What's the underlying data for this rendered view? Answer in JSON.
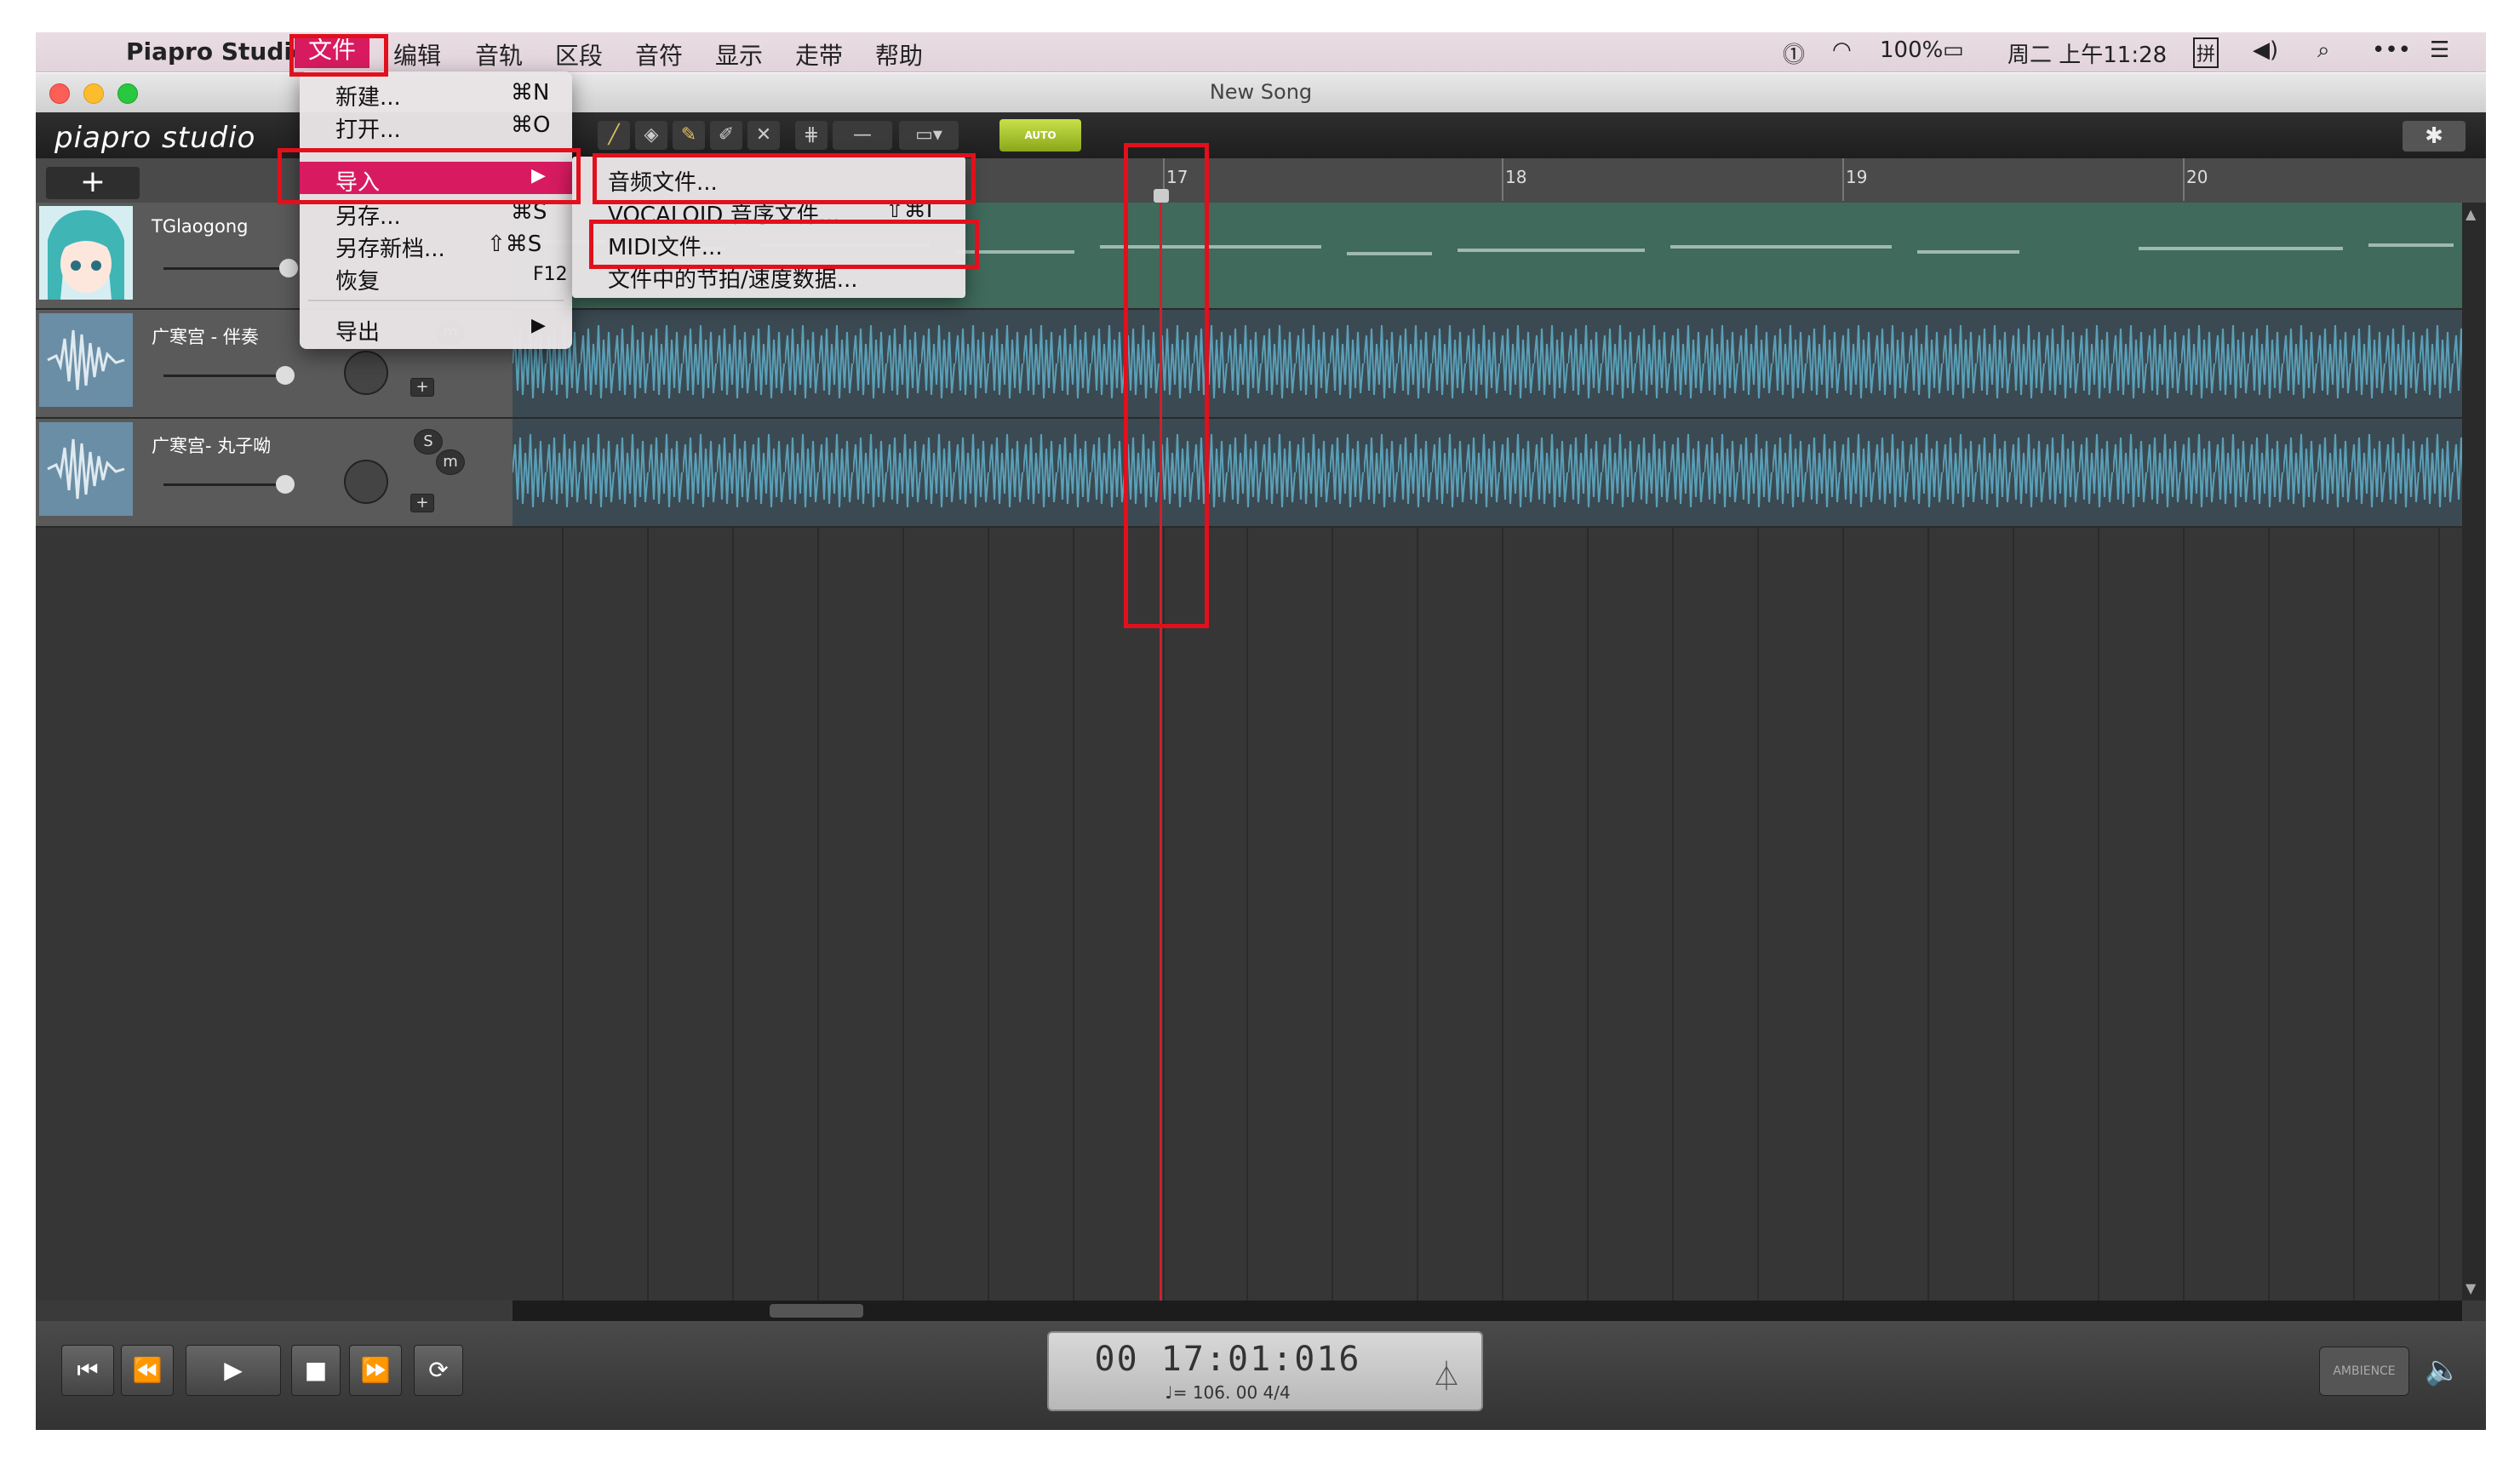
{
  "menubar": {
    "apple_icon": "apple-icon",
    "app_name": "Piapro Studio",
    "items": [
      "文件",
      "编辑",
      "音轨",
      "区段",
      "音符",
      "显示",
      "走带",
      "帮助"
    ],
    "status": {
      "battery": "100%",
      "clock": "周二 上午11:28",
      "input_method": "拼"
    }
  },
  "window": {
    "title": "New Song",
    "logo": "piapro studio",
    "auto_label": "AUTO"
  },
  "ruler": {
    "add_label": "+",
    "bars": [
      "17",
      "18",
      "19",
      "20"
    ]
  },
  "tracks": [
    {
      "name": "TGlaogong",
      "type": "vocal"
    },
    {
      "name": "广寒宫 - 伴奏",
      "type": "audio",
      "m": "m",
      "plus": "+"
    },
    {
      "name": "广寒宫- 丸子呦",
      "type": "audio",
      "s": "S",
      "m": "m",
      "plus": "+"
    }
  ],
  "file_menu": {
    "items": [
      {
        "label": "新建...",
        "shortcut": "⌘N"
      },
      {
        "label": "打开...",
        "shortcut": "⌘O"
      },
      {
        "label": "导入",
        "shortcut": "▶"
      },
      {
        "label": "另存...",
        "shortcut": "⌘S"
      },
      {
        "label": "另存新档...",
        "shortcut": "⇧⌘S"
      },
      {
        "label": "恢复",
        "shortcut": "F12"
      },
      {
        "label": "导出",
        "shortcut": "▶"
      }
    ]
  },
  "import_submenu": {
    "items": [
      {
        "label": "音频文件...",
        "shortcut": ""
      },
      {
        "label": "VOCALOID 音序文件...",
        "shortcut": "⇧⌘I"
      },
      {
        "label": "MIDI文件...",
        "shortcut": ""
      },
      {
        "label": "文件中的节拍/速度数据...",
        "shortcut": ""
      }
    ]
  },
  "transport": {
    "time": "00 17:01:016",
    "tempo_sig": "♩= 106. 00   4/4",
    "ambience": "AMBIENCE"
  },
  "colors": {
    "highlight": "#d81b60",
    "annotation": "#e1101c",
    "playhead": "#d0202a",
    "vocal_lane": "#3f6a5c",
    "wave": "#5a9fb8"
  }
}
